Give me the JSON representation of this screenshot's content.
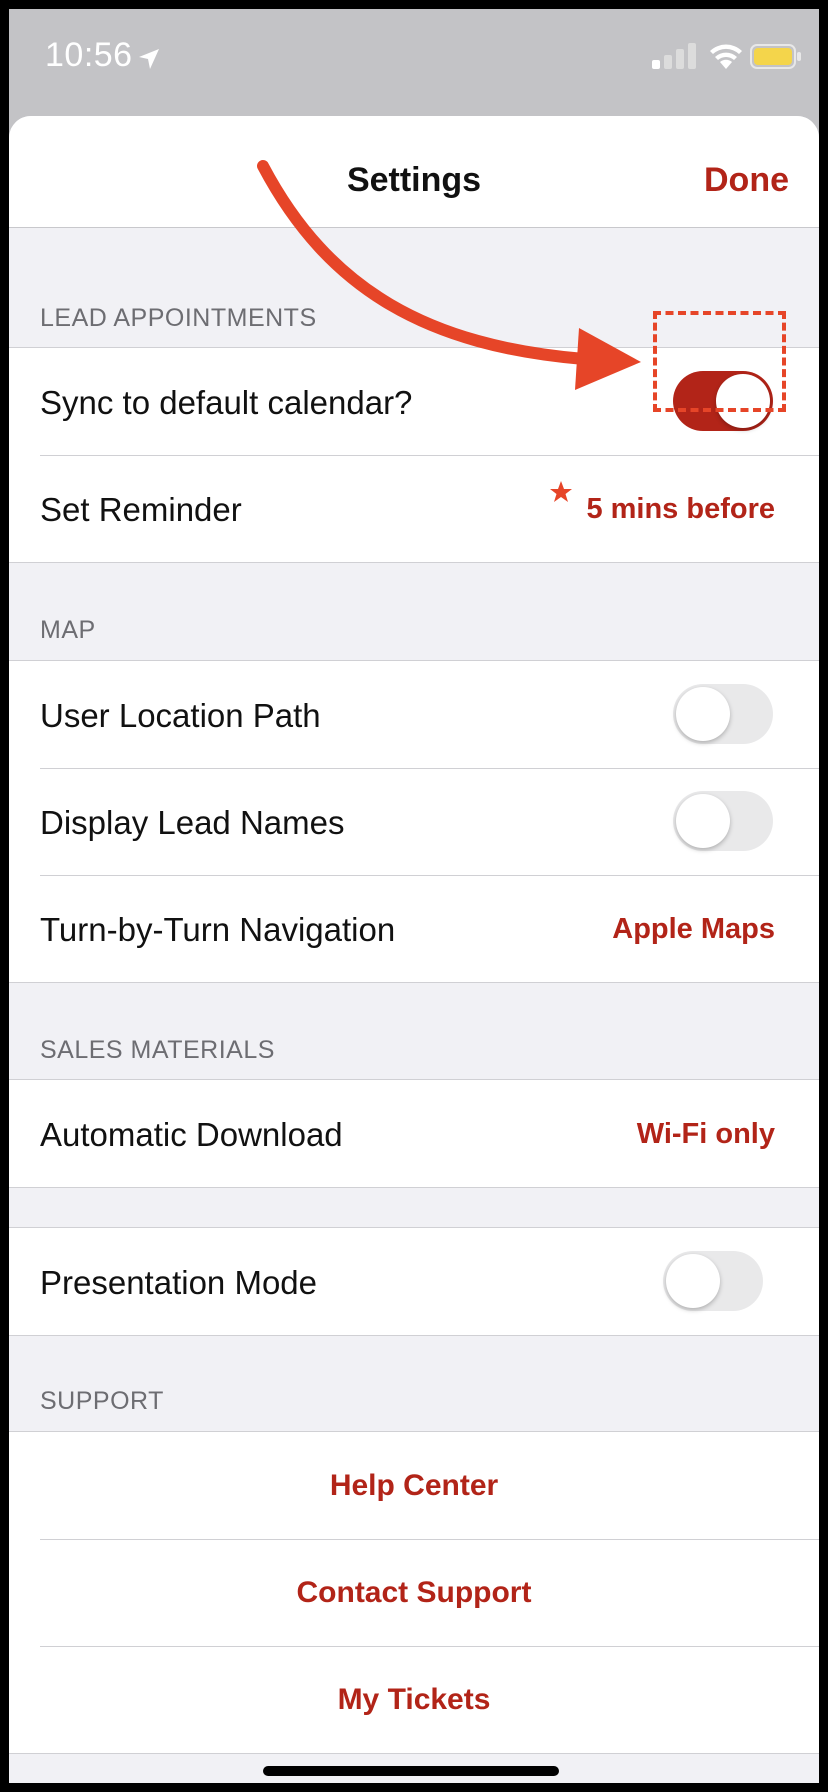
{
  "status_bar": {
    "time": "10:56",
    "icons": [
      "location-arrow-icon",
      "cellular-signal-icon",
      "wifi-icon",
      "battery-icon"
    ],
    "battery_color": "#f4d54b"
  },
  "nav": {
    "title": "Settings",
    "done_label": "Done"
  },
  "sections": {
    "lead_appointments": {
      "header": "LEAD APPOINTMENTS",
      "sync_label": "Sync to default calendar?",
      "sync_on": true,
      "reminder_label": "Set Reminder",
      "reminder_value": "5 mins before"
    },
    "map": {
      "header": "MAP",
      "location_path_label": "User Location Path",
      "location_path_on": false,
      "lead_names_label": "Display Lead Names",
      "lead_names_on": false,
      "navigation_label": "Turn-by-Turn Navigation",
      "navigation_value": "Apple Maps"
    },
    "sales_materials": {
      "header": "SALES MATERIALS",
      "download_label": "Automatic Download",
      "download_value": "Wi-Fi only"
    },
    "presentation": {
      "mode_label": "Presentation Mode",
      "mode_on": false
    },
    "support": {
      "header": "SUPPORT",
      "help_center": "Help Center",
      "contact_support": "Contact Support",
      "my_tickets": "My Tickets"
    }
  },
  "colors": {
    "accent": "#b22418",
    "annotation": "#e64528",
    "background": "#f1f1f5"
  }
}
